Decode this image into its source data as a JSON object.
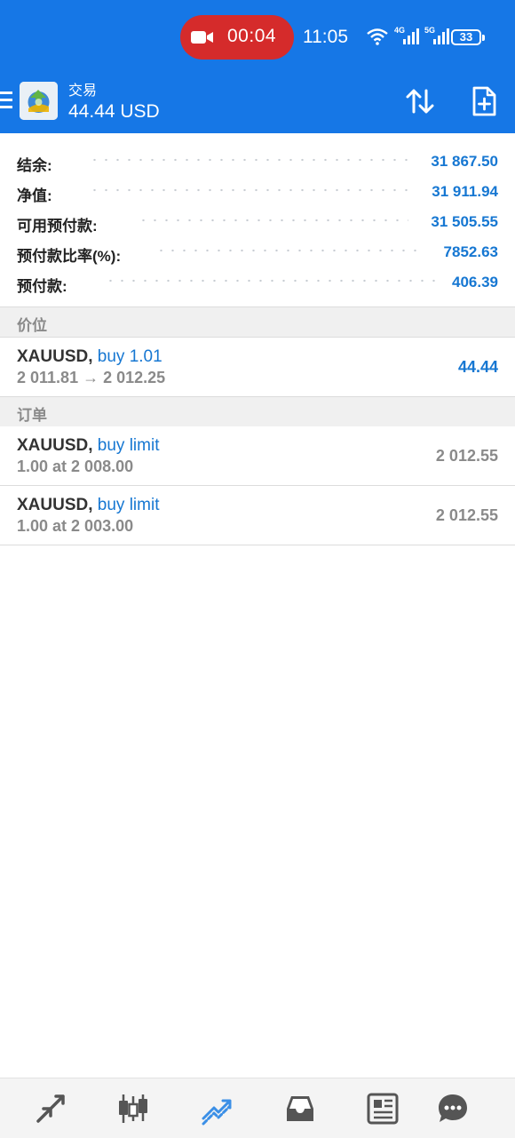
{
  "status_bar": {
    "record_time": "00:04",
    "clock": "11:05",
    "network1": "4G",
    "network2": "5G",
    "battery": "33"
  },
  "header": {
    "title": "交易",
    "balance": "44.44 USD"
  },
  "summary": [
    {
      "label": "结余:",
      "value": "31 867.50"
    },
    {
      "label": "净值:",
      "value": "31 911.94"
    },
    {
      "label": "可用预付款:",
      "value": "31 505.55"
    },
    {
      "label": "预付款比率(%):",
      "value": "7852.63"
    },
    {
      "label": "预付款:",
      "value": "406.39"
    }
  ],
  "positions_section": {
    "title": "价位"
  },
  "positions": [
    {
      "symbol": "XAUUSD,",
      "action": "buy 1.01",
      "detail": "2 011.81 → 2 012.25",
      "profit": "44.44"
    }
  ],
  "orders_section": {
    "title": "订单"
  },
  "orders": [
    {
      "symbol": "XAUUSD,",
      "action": "buy limit",
      "detail": "1.00 at 2 008.00",
      "price": "2 012.55"
    },
    {
      "symbol": "XAUUSD,",
      "action": "buy limit",
      "detail": "1.00 at 2 003.00",
      "price": "2 012.55"
    }
  ],
  "bottom_nav": {
    "items": [
      "quotes-icon",
      "chart-icon",
      "trade-icon",
      "history-icon",
      "news-icon",
      "chat-icon"
    ],
    "active": "trade-icon"
  },
  "colors": {
    "header": "#1677e6",
    "accent_blue": "#1677d2",
    "record": "#d52b2b"
  }
}
